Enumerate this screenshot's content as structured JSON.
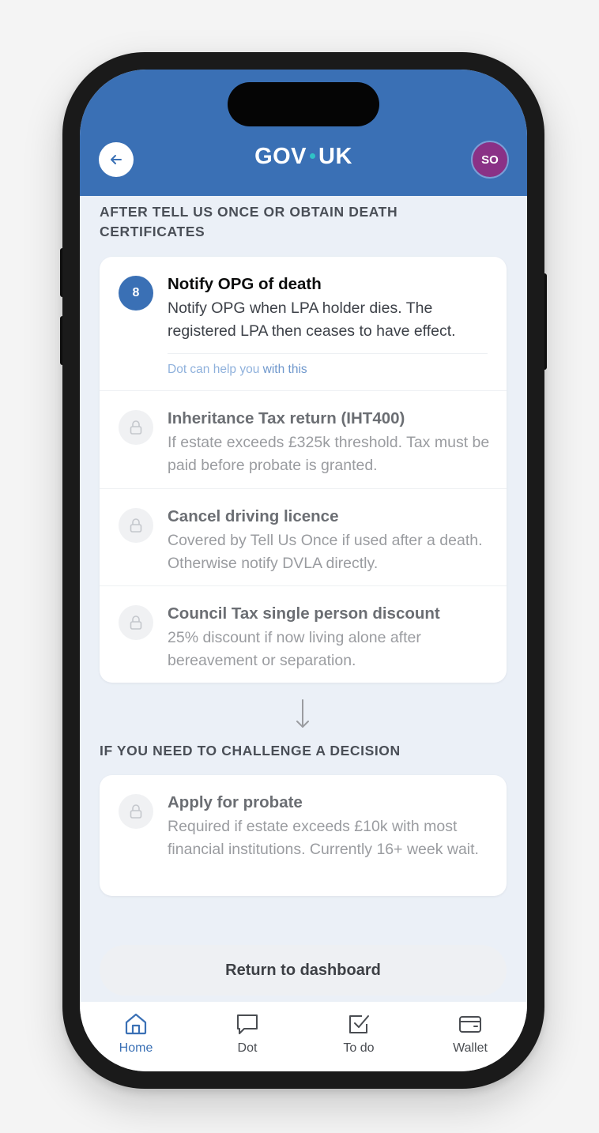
{
  "header": {
    "logo_left": "GOV",
    "logo_right": "UK",
    "avatar_initials": "SO"
  },
  "section1": {
    "title": "AFTER TELL US ONCE OR OBTAIN DEATH CERTIFICATES",
    "tasks": [
      {
        "number": "8",
        "title": "Notify OPG of death",
        "description": "Notify OPG when LPA holder dies. The registered LPA then ceases to have effect.",
        "help_prefix": "Dot can help you ",
        "help_strong": "with this",
        "state": "active"
      },
      {
        "title": "Inheritance Tax return (IHT400)",
        "description": "If estate exceeds £325k threshold. Tax must be paid before probate is granted.",
        "state": "locked"
      },
      {
        "title": "Cancel driving licence",
        "description": "Covered by Tell Us Once if used after a death. Otherwise notify DVLA directly.",
        "state": "locked"
      },
      {
        "title": "Council Tax single person discount",
        "description": "25% discount if now living alone after bereavement or separation.",
        "state": "locked"
      }
    ]
  },
  "section2": {
    "title": "IF YOU NEED TO CHALLENGE A DECISION",
    "tasks": [
      {
        "title": "Apply for probate",
        "description": "Required if estate exceeds £10k with most financial institutions. Currently 16+ week wait.",
        "state": "locked"
      }
    ]
  },
  "return_button": "Return to dashboard",
  "nav": {
    "items": [
      {
        "label": "Home",
        "icon": "home-icon",
        "active": true
      },
      {
        "label": "Dot",
        "icon": "chat-icon",
        "active": false
      },
      {
        "label": "To do",
        "icon": "checkbox-icon",
        "active": false
      },
      {
        "label": "Wallet",
        "icon": "wallet-icon",
        "active": false
      }
    ]
  },
  "colors": {
    "header_blue": "#3a70b5",
    "avatar_purple": "#8a3186",
    "logo_dot": "#2fc3c6",
    "background": "#ebf0f7"
  }
}
